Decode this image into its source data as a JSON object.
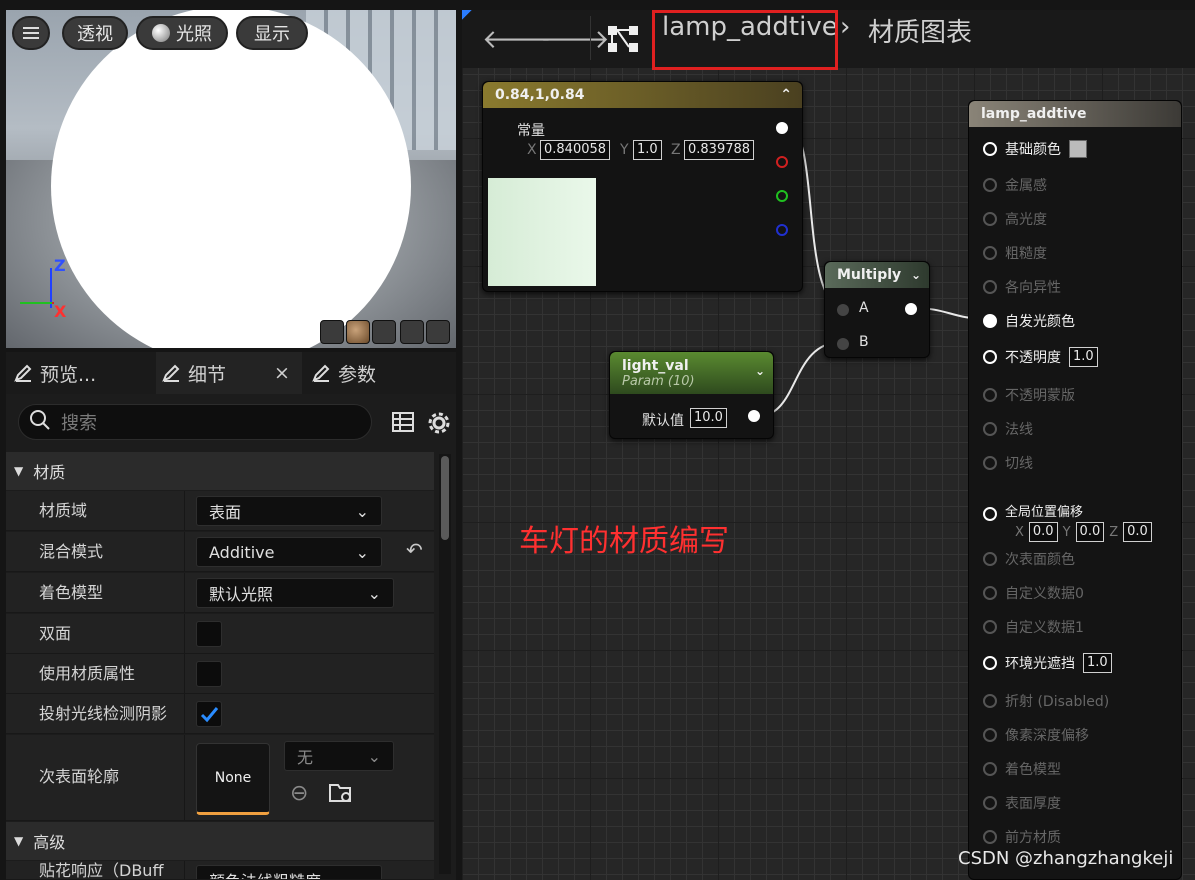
{
  "viewport": {
    "menu_icon": "hamburger-icon",
    "buttons": {
      "perspective": "透视",
      "lighting": "光照",
      "show": "显示"
    },
    "axes": {
      "z": "Z",
      "x": "X"
    }
  },
  "tabs": {
    "preview": "预览...",
    "details": "细节",
    "close": "×",
    "params": "参数"
  },
  "details": {
    "search_placeholder": "搜索",
    "category_material": "材质",
    "rows": {
      "domain_label": "材质域",
      "domain_value": "表面",
      "blend_label": "混合模式",
      "blend_value": "Additive",
      "shading_label": "着色模型",
      "shading_value": "默认光照",
      "twosided_label": "双面",
      "attrs_label": "使用材质属性",
      "raytrace_label": "投射光线检测阴影",
      "subsurface_label": "次表面轮廓",
      "subsurface_asset": "None",
      "subsurface_dd": "无"
    },
    "category_advanced": "高级",
    "cut_row_label": "贴花响应（DBuff",
    "cut_row_value": "颜色法线粗糙度"
  },
  "graph": {
    "breadcrumb_asset": "lamp_addtive",
    "breadcrumb_sep": "›",
    "breadcrumb_page": "材质图表",
    "const_node": {
      "title": "0.84,1,0.84",
      "label": "常量",
      "x_label": "X",
      "x": "0.840058",
      "y_label": "Y",
      "y": "1.0",
      "z_label": "Z",
      "z": "0.839788"
    },
    "param_node": {
      "title": "light_val",
      "subtitle": "Param (10)",
      "label": "默认值",
      "value": "10.0"
    },
    "multiply_node": {
      "title": "Multiply",
      "a": "A",
      "b": "B"
    },
    "result_node": {
      "title": "lamp_addtive",
      "base_color": "基础颜色",
      "metallic": "金属感",
      "specular": "高光度",
      "roughness": "粗糙度",
      "anisotropy": "各向异性",
      "emissive": "自发光颜色",
      "opacity": "不透明度",
      "opacity_val": "1.0",
      "opacity_mask": "不透明蒙版",
      "normal": "法线",
      "tangent": "切线",
      "wpo": "全局位置偏移",
      "wpo_x_label": "X",
      "wpo_x": "0.0",
      "wpo_y_label": "Y",
      "wpo_y": "0.0",
      "wpo_z_label": "Z",
      "wpo_z": "0.0",
      "subsurface": "次表面颜色",
      "custom0": "自定义数据0",
      "custom1": "自定义数据1",
      "ao": "环境光遮挡",
      "ao_val": "1.0",
      "refraction": "折射 (Disabled)",
      "pdo": "像素深度偏移",
      "shading_model": "着色模型",
      "thickness": "表面厚度",
      "front": "前方材质"
    },
    "annotation": "车灯的材质编写",
    "watermark": "CSDN @zhangzhangkeji"
  },
  "colors": {
    "accent_red": "#e02020",
    "const_header": "#8a7a2e",
    "param_header": "#4e7a2e",
    "multiply_header": "#5a6a5a",
    "result_header": "#8a8478"
  }
}
